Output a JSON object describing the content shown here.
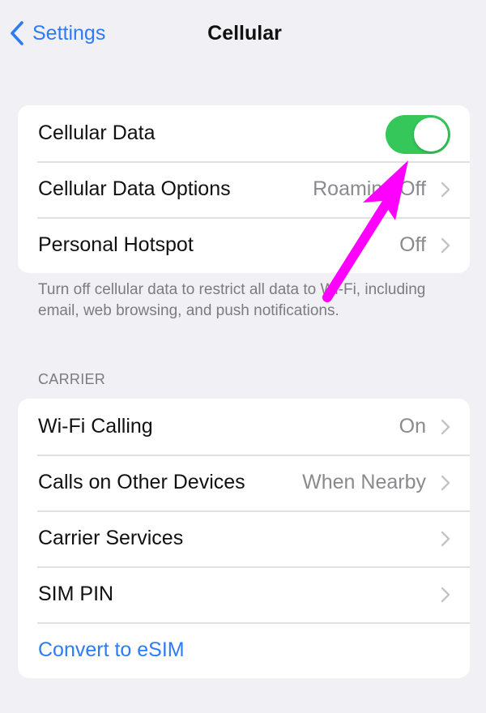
{
  "navbar": {
    "back_label": "Settings",
    "back_icon": "chevron-left-icon",
    "title": "Cellular"
  },
  "colors": {
    "accent": "#2d7cf6",
    "toggle_on": "#35c759",
    "background": "#f1f0f5",
    "annotation_arrow": "#ff00ff",
    "secondary_text": "#8a8a8e"
  },
  "group1": {
    "rows": [
      {
        "label": "Cellular Data",
        "toggle_on": true
      },
      {
        "label": "Cellular Data Options",
        "value": "Roaming Off"
      },
      {
        "label": "Personal Hotspot",
        "value": "Off"
      }
    ],
    "footer": "Turn off cellular data to restrict all data to Wi-Fi, including email, web browsing, and push notifications."
  },
  "carrier": {
    "header": "CARRIER",
    "rows": [
      {
        "label": "Wi-Fi Calling",
        "value": "On"
      },
      {
        "label": "Calls on Other Devices",
        "value": "When Nearby"
      },
      {
        "label": "Carrier Services",
        "value": ""
      },
      {
        "label": "SIM PIN",
        "value": ""
      },
      {
        "label": "Convert to eSIM",
        "link": true
      }
    ]
  },
  "annotation": {
    "type": "arrow",
    "points_to": "Cellular Data toggle"
  }
}
